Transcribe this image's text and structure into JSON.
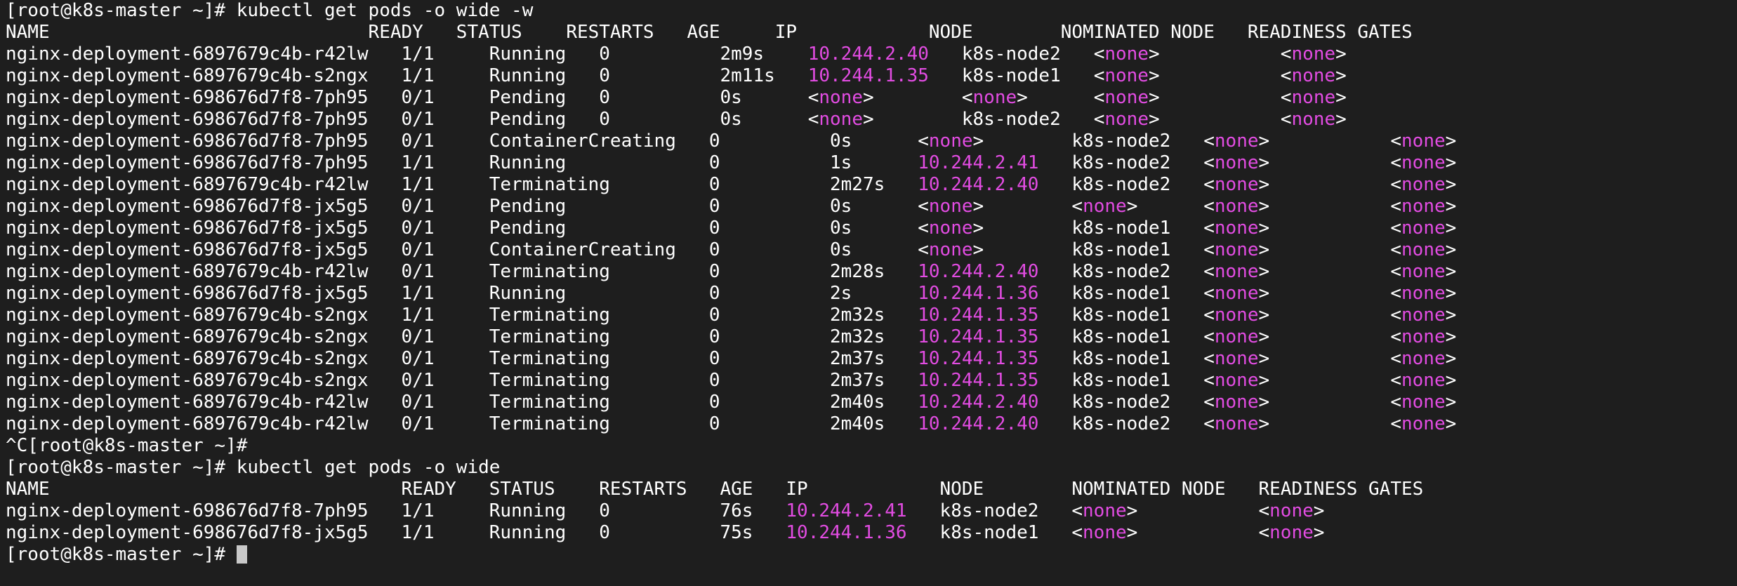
{
  "palette": {
    "background": "#1e1e1e",
    "text": "#ffffff",
    "highlight": "#e24ce2",
    "cursor": "#c8c8c8"
  },
  "terminal": {
    "lines": [
      {
        "kind": "command",
        "segments": [
          {
            "t": "[root@k8s-master ~]# kubectl get pods -o wide -w",
            "c": "w"
          }
        ]
      },
      {
        "kind": "header",
        "segments": [
          {
            "t": "NAME                             READY   STATUS    RESTARTS   AGE     IP            NODE        NOMINATED NODE   READINESS GATES",
            "c": "w"
          }
        ]
      },
      {
        "kind": "output",
        "segments": [
          {
            "t": "nginx-deployment-6897679c4b-r42lw   1/1     Running   0          2m9s    ",
            "c": "w"
          },
          {
            "t": "10.244.2.40",
            "c": "m"
          },
          {
            "t": "   k8s-node2   <",
            "c": "w"
          },
          {
            "t": "none",
            "c": "m"
          },
          {
            "t": ">           <",
            "c": "w"
          },
          {
            "t": "none",
            "c": "m"
          },
          {
            "t": ">",
            "c": "w"
          }
        ]
      },
      {
        "kind": "output",
        "segments": [
          {
            "t": "nginx-deployment-6897679c4b-s2ngx   1/1     Running   0          2m11s   ",
            "c": "w"
          },
          {
            "t": "10.244.1.35",
            "c": "m"
          },
          {
            "t": "   k8s-node1   <",
            "c": "w"
          },
          {
            "t": "none",
            "c": "m"
          },
          {
            "t": ">           <",
            "c": "w"
          },
          {
            "t": "none",
            "c": "m"
          },
          {
            "t": ">",
            "c": "w"
          }
        ]
      },
      {
        "kind": "output",
        "segments": [
          {
            "t": "nginx-deployment-698676d7f8-7ph95   0/1     Pending   0          0s      <",
            "c": "w"
          },
          {
            "t": "none",
            "c": "m"
          },
          {
            "t": ">        <",
            "c": "w"
          },
          {
            "t": "none",
            "c": "m"
          },
          {
            "t": ">      <",
            "c": "w"
          },
          {
            "t": "none",
            "c": "m"
          },
          {
            "t": ">           <",
            "c": "w"
          },
          {
            "t": "none",
            "c": "m"
          },
          {
            "t": ">",
            "c": "w"
          }
        ]
      },
      {
        "kind": "output",
        "segments": [
          {
            "t": "nginx-deployment-698676d7f8-7ph95   0/1     Pending   0          0s      <",
            "c": "w"
          },
          {
            "t": "none",
            "c": "m"
          },
          {
            "t": ">        k8s-node2   <",
            "c": "w"
          },
          {
            "t": "none",
            "c": "m"
          },
          {
            "t": ">           <",
            "c": "w"
          },
          {
            "t": "none",
            "c": "m"
          },
          {
            "t": ">",
            "c": "w"
          }
        ]
      },
      {
        "kind": "output",
        "segments": [
          {
            "t": "nginx-deployment-698676d7f8-7ph95   0/1     ContainerCreating   0          0s      <",
            "c": "w"
          },
          {
            "t": "none",
            "c": "m"
          },
          {
            "t": ">        k8s-node2   <",
            "c": "w"
          },
          {
            "t": "none",
            "c": "m"
          },
          {
            "t": ">           <",
            "c": "w"
          },
          {
            "t": "none",
            "c": "m"
          },
          {
            "t": ">",
            "c": "w"
          }
        ]
      },
      {
        "kind": "output",
        "segments": [
          {
            "t": "nginx-deployment-698676d7f8-7ph95   1/1     Running             0          1s      ",
            "c": "w"
          },
          {
            "t": "10.244.2.41",
            "c": "m"
          },
          {
            "t": "   k8s-node2   <",
            "c": "w"
          },
          {
            "t": "none",
            "c": "m"
          },
          {
            "t": ">           <",
            "c": "w"
          },
          {
            "t": "none",
            "c": "m"
          },
          {
            "t": ">",
            "c": "w"
          }
        ]
      },
      {
        "kind": "output",
        "segments": [
          {
            "t": "nginx-deployment-6897679c4b-r42lw   1/1     Terminating         0          2m27s   ",
            "c": "w"
          },
          {
            "t": "10.244.2.40",
            "c": "m"
          },
          {
            "t": "   k8s-node2   <",
            "c": "w"
          },
          {
            "t": "none",
            "c": "m"
          },
          {
            "t": ">           <",
            "c": "w"
          },
          {
            "t": "none",
            "c": "m"
          },
          {
            "t": ">",
            "c": "w"
          }
        ]
      },
      {
        "kind": "output",
        "segments": [
          {
            "t": "nginx-deployment-698676d7f8-jx5g5   0/1     Pending             0          0s      <",
            "c": "w"
          },
          {
            "t": "none",
            "c": "m"
          },
          {
            "t": ">        <",
            "c": "w"
          },
          {
            "t": "none",
            "c": "m"
          },
          {
            "t": ">      <",
            "c": "w"
          },
          {
            "t": "none",
            "c": "m"
          },
          {
            "t": ">           <",
            "c": "w"
          },
          {
            "t": "none",
            "c": "m"
          },
          {
            "t": ">",
            "c": "w"
          }
        ]
      },
      {
        "kind": "output",
        "segments": [
          {
            "t": "nginx-deployment-698676d7f8-jx5g5   0/1     Pending             0          0s      <",
            "c": "w"
          },
          {
            "t": "none",
            "c": "m"
          },
          {
            "t": ">        k8s-node1   <",
            "c": "w"
          },
          {
            "t": "none",
            "c": "m"
          },
          {
            "t": ">           <",
            "c": "w"
          },
          {
            "t": "none",
            "c": "m"
          },
          {
            "t": ">",
            "c": "w"
          }
        ]
      },
      {
        "kind": "output",
        "segments": [
          {
            "t": "nginx-deployment-698676d7f8-jx5g5   0/1     ContainerCreating   0          0s      <",
            "c": "w"
          },
          {
            "t": "none",
            "c": "m"
          },
          {
            "t": ">        k8s-node1   <",
            "c": "w"
          },
          {
            "t": "none",
            "c": "m"
          },
          {
            "t": ">           <",
            "c": "w"
          },
          {
            "t": "none",
            "c": "m"
          },
          {
            "t": ">",
            "c": "w"
          }
        ]
      },
      {
        "kind": "output",
        "segments": [
          {
            "t": "nginx-deployment-6897679c4b-r42lw   0/1     Terminating         0          2m28s   ",
            "c": "w"
          },
          {
            "t": "10.244.2.40",
            "c": "m"
          },
          {
            "t": "   k8s-node2   <",
            "c": "w"
          },
          {
            "t": "none",
            "c": "m"
          },
          {
            "t": ">           <",
            "c": "w"
          },
          {
            "t": "none",
            "c": "m"
          },
          {
            "t": ">",
            "c": "w"
          }
        ]
      },
      {
        "kind": "output",
        "segments": [
          {
            "t": "nginx-deployment-698676d7f8-jx5g5   1/1     Running             0          2s      ",
            "c": "w"
          },
          {
            "t": "10.244.1.36",
            "c": "m"
          },
          {
            "t": "   k8s-node1   <",
            "c": "w"
          },
          {
            "t": "none",
            "c": "m"
          },
          {
            "t": ">           <",
            "c": "w"
          },
          {
            "t": "none",
            "c": "m"
          },
          {
            "t": ">",
            "c": "w"
          }
        ]
      },
      {
        "kind": "output",
        "segments": [
          {
            "t": "nginx-deployment-6897679c4b-s2ngx   1/1     Terminating         0          2m32s   ",
            "c": "w"
          },
          {
            "t": "10.244.1.35",
            "c": "m"
          },
          {
            "t": "   k8s-node1   <",
            "c": "w"
          },
          {
            "t": "none",
            "c": "m"
          },
          {
            "t": ">           <",
            "c": "w"
          },
          {
            "t": "none",
            "c": "m"
          },
          {
            "t": ">",
            "c": "w"
          }
        ]
      },
      {
        "kind": "output",
        "segments": [
          {
            "t": "nginx-deployment-6897679c4b-s2ngx   0/1     Terminating         0          2m32s   ",
            "c": "w"
          },
          {
            "t": "10.244.1.35",
            "c": "m"
          },
          {
            "t": "   k8s-node1   <",
            "c": "w"
          },
          {
            "t": "none",
            "c": "m"
          },
          {
            "t": ">           <",
            "c": "w"
          },
          {
            "t": "none",
            "c": "m"
          },
          {
            "t": ">",
            "c": "w"
          }
        ]
      },
      {
        "kind": "output",
        "segments": [
          {
            "t": "nginx-deployment-6897679c4b-s2ngx   0/1     Terminating         0          2m37s   ",
            "c": "w"
          },
          {
            "t": "10.244.1.35",
            "c": "m"
          },
          {
            "t": "   k8s-node1   <",
            "c": "w"
          },
          {
            "t": "none",
            "c": "m"
          },
          {
            "t": ">           <",
            "c": "w"
          },
          {
            "t": "none",
            "c": "m"
          },
          {
            "t": ">",
            "c": "w"
          }
        ]
      },
      {
        "kind": "output",
        "segments": [
          {
            "t": "nginx-deployment-6897679c4b-s2ngx   0/1     Terminating         0          2m37s   ",
            "c": "w"
          },
          {
            "t": "10.244.1.35",
            "c": "m"
          },
          {
            "t": "   k8s-node1   <",
            "c": "w"
          },
          {
            "t": "none",
            "c": "m"
          },
          {
            "t": ">           <",
            "c": "w"
          },
          {
            "t": "none",
            "c": "m"
          },
          {
            "t": ">",
            "c": "w"
          }
        ]
      },
      {
        "kind": "output",
        "segments": [
          {
            "t": "nginx-deployment-6897679c4b-r42lw   0/1     Terminating         0          2m40s   ",
            "c": "w"
          },
          {
            "t": "10.244.2.40",
            "c": "m"
          },
          {
            "t": "   k8s-node2   <",
            "c": "w"
          },
          {
            "t": "none",
            "c": "m"
          },
          {
            "t": ">           <",
            "c": "w"
          },
          {
            "t": "none",
            "c": "m"
          },
          {
            "t": ">",
            "c": "w"
          }
        ]
      },
      {
        "kind": "output",
        "segments": [
          {
            "t": "nginx-deployment-6897679c4b-r42lw   0/1     Terminating         0          2m40s   ",
            "c": "w"
          },
          {
            "t": "10.244.2.40",
            "c": "m"
          },
          {
            "t": "   k8s-node2   <",
            "c": "w"
          },
          {
            "t": "none",
            "c": "m"
          },
          {
            "t": ">           <",
            "c": "w"
          },
          {
            "t": "none",
            "c": "m"
          },
          {
            "t": ">",
            "c": "w"
          }
        ]
      },
      {
        "kind": "command",
        "segments": [
          {
            "t": "^C[root@k8s-master ~]#",
            "c": "w"
          }
        ]
      },
      {
        "kind": "command",
        "segments": [
          {
            "t": "[root@k8s-master ~]# kubectl get pods -o wide",
            "c": "w"
          }
        ]
      },
      {
        "kind": "header",
        "segments": [
          {
            "t": "NAME                                READY   STATUS    RESTARTS   AGE   IP            NODE        NOMINATED NODE   READINESS GATES",
            "c": "w"
          }
        ]
      },
      {
        "kind": "output",
        "segments": [
          {
            "t": "nginx-deployment-698676d7f8-7ph95   1/1     Running   0          76s   ",
            "c": "w"
          },
          {
            "t": "10.244.2.41",
            "c": "m"
          },
          {
            "t": "   k8s-node2   <",
            "c": "w"
          },
          {
            "t": "none",
            "c": "m"
          },
          {
            "t": ">           <",
            "c": "w"
          },
          {
            "t": "none",
            "c": "m"
          },
          {
            "t": ">",
            "c": "w"
          }
        ]
      },
      {
        "kind": "output",
        "segments": [
          {
            "t": "nginx-deployment-698676d7f8-jx5g5   1/1     Running   0          75s   ",
            "c": "w"
          },
          {
            "t": "10.244.1.36",
            "c": "m"
          },
          {
            "t": "   k8s-node1   <",
            "c": "w"
          },
          {
            "t": "none",
            "c": "m"
          },
          {
            "t": ">           <",
            "c": "w"
          },
          {
            "t": "none",
            "c": "m"
          },
          {
            "t": ">",
            "c": "w"
          }
        ]
      },
      {
        "kind": "prompt",
        "segments": [
          {
            "t": "[root@k8s-master ~]# ",
            "c": "w"
          }
        ]
      }
    ]
  }
}
